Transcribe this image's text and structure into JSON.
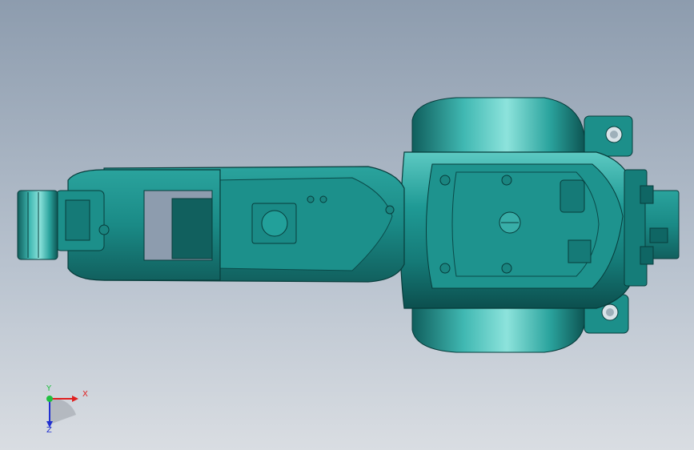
{
  "scene": {
    "background_top": "#8d9cae",
    "background_bottom": "#d9dde2",
    "model_color": "#1f8f8c",
    "model_dark": "#0e5a59",
    "model_highlight": "#4fc6c0"
  },
  "triad": {
    "x_label": "X",
    "y_label": "Y",
    "z_label": "Z",
    "x_color": "#e02020",
    "y_color": "#20c040",
    "z_color": "#2030d0"
  }
}
